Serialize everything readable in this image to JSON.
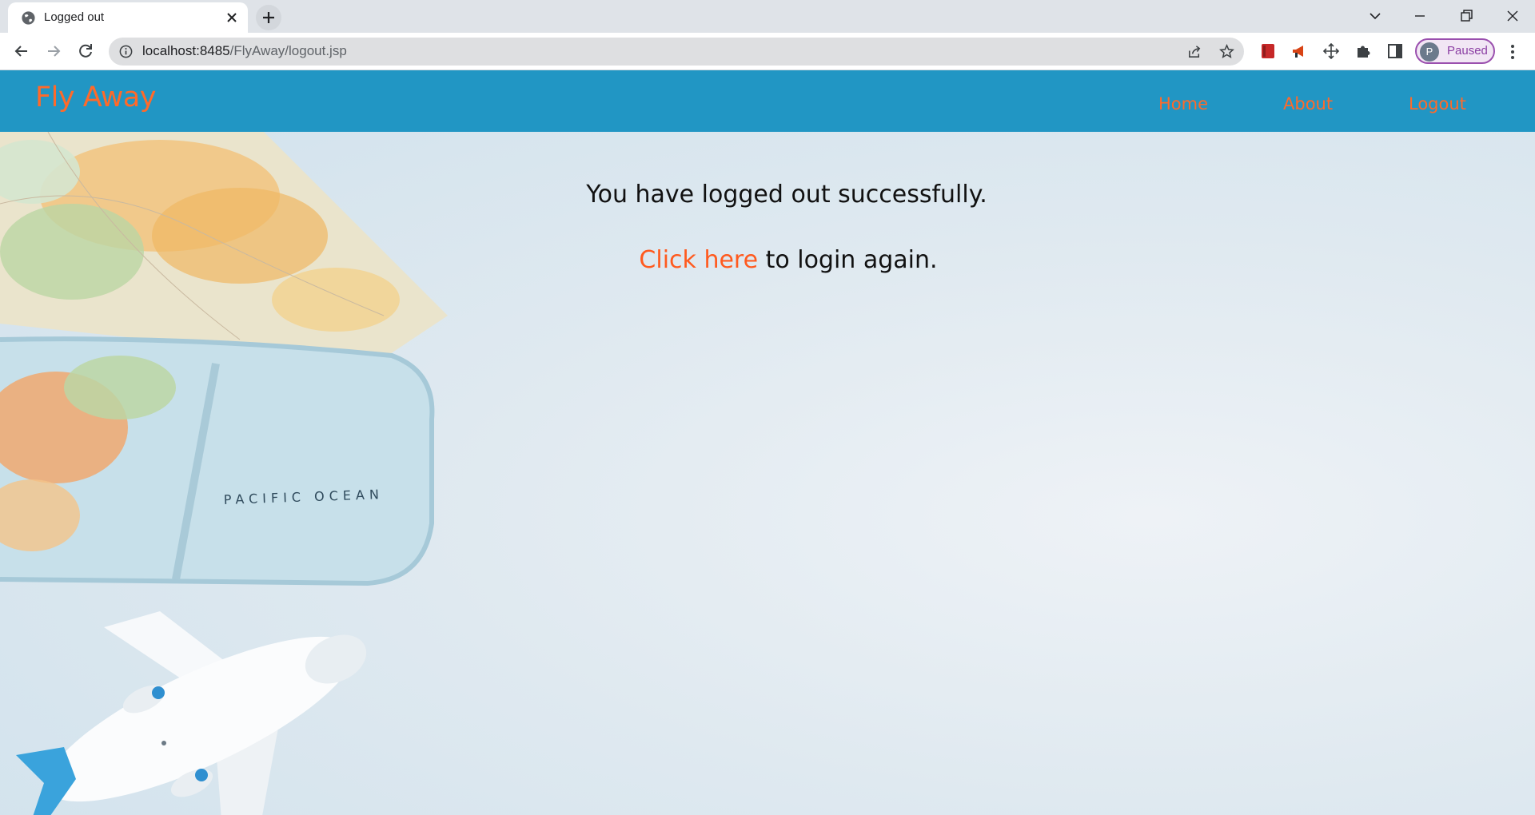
{
  "browser": {
    "tab_title": "Logged out",
    "url_host": "localhost:8485",
    "url_path": "/FlyAway/logout.jsp",
    "profile_initial": "P",
    "profile_status": "Paused"
  },
  "header": {
    "brand": "Fly Away",
    "nav": {
      "home": "Home",
      "about": "About",
      "logout": "Logout"
    }
  },
  "main": {
    "message": "You have logged out successfully.",
    "link_text": "Click here",
    "link_suffix": " to login again."
  },
  "background": {
    "map_label": "PACIFIC OCEAN"
  },
  "colors": {
    "header_bg": "#2196c4",
    "accent": "#ff6a2a"
  }
}
